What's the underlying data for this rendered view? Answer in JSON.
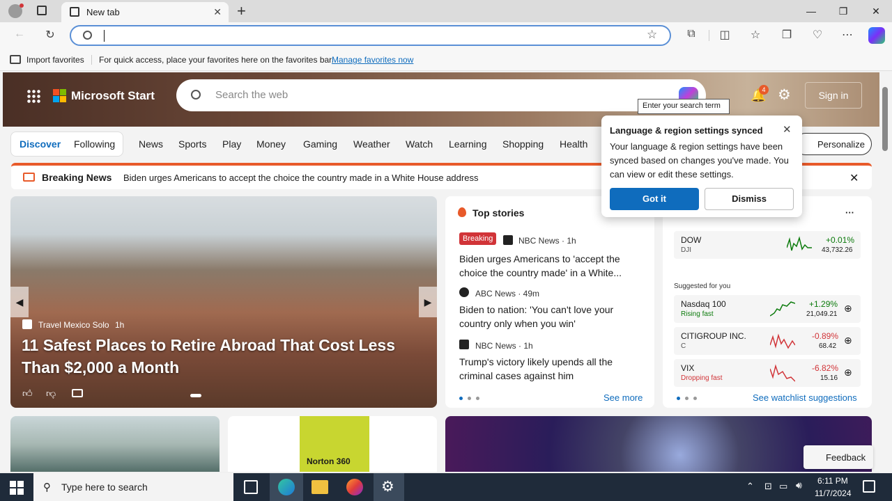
{
  "browser": {
    "tab_title": "New tab",
    "new_tab": "+",
    "close_tab": "✕",
    "minimize": "—",
    "maximize": "❐",
    "close": "✕"
  },
  "favorites": {
    "import": "Import favorites",
    "message": "For quick access, place your favorites here on the favorites bar.",
    "manage": "Manage favorites now"
  },
  "header": {
    "brand": "Microsoft Start",
    "search_placeholder": "Search the web",
    "tooltip": "Enter your search term",
    "notif_count": "4",
    "signin": "Sign in"
  },
  "nav": {
    "discover": "Discover",
    "following": "Following",
    "items": [
      "News",
      "Sports",
      "Play",
      "Money",
      "Gaming",
      "Weather",
      "Watch",
      "Learning",
      "Shopping",
      "Health"
    ],
    "personalize": "Personalize"
  },
  "breaking": {
    "label": "Breaking News",
    "text": "Biden urges Americans to accept the choice the country made in a White House address"
  },
  "hero": {
    "source": "Travel Mexico Solo",
    "age": "1h",
    "title": "11 Safest Places to Retire Abroad That Cost Less Than $2,000 a Month"
  },
  "stories": {
    "title": "Top stories",
    "badge": "Breaking",
    "items": [
      {
        "source": "NBC News · 1h",
        "headline": "Biden urges Americans to 'accept the choice the country made' in a White..."
      },
      {
        "source": "ABC News · 49m",
        "headline": "Biden to nation: 'You can't love your country only when you win'"
      },
      {
        "source": "NBC News · 1h",
        "headline": "Trump's victory likely upends all the criminal cases against him"
      }
    ],
    "see_more": "See more"
  },
  "markets": {
    "more": "···",
    "dow": {
      "name": "DOW",
      "sub": "DJI",
      "change": "+0.01%",
      "value": "43,732.26"
    },
    "suggested": "Suggested for you",
    "rows": [
      {
        "name": "Nasdaq 100",
        "sub": "Rising fast",
        "change": "+1.29%",
        "value": "21,049.21",
        "up": true
      },
      {
        "name": "CITIGROUP INC.",
        "sub": "C",
        "change": "-0.89%",
        "value": "68.42",
        "up": false
      },
      {
        "name": "VIX",
        "sub": "Dropping fast",
        "change": "-6.82%",
        "value": "15.16",
        "up": false
      }
    ],
    "see_watchlist": "See watchlist suggestions"
  },
  "popup": {
    "title": "Language & region settings synced",
    "body": "Your language & region settings have been synced based on changes you've made. You can view or edit these settings.",
    "got_it": "Got it",
    "dismiss": "Dismiss"
  },
  "bottom": {
    "norton": "Norton 360",
    "feedback": "Feedback"
  },
  "taskbar": {
    "search": "Type here to search",
    "time": "6:11 PM",
    "date": "11/7/2024"
  },
  "colors": {
    "accent": "#0f6cbd",
    "up": "#0b7a0b",
    "down": "#d13438",
    "breaking": "#e85a2a"
  }
}
